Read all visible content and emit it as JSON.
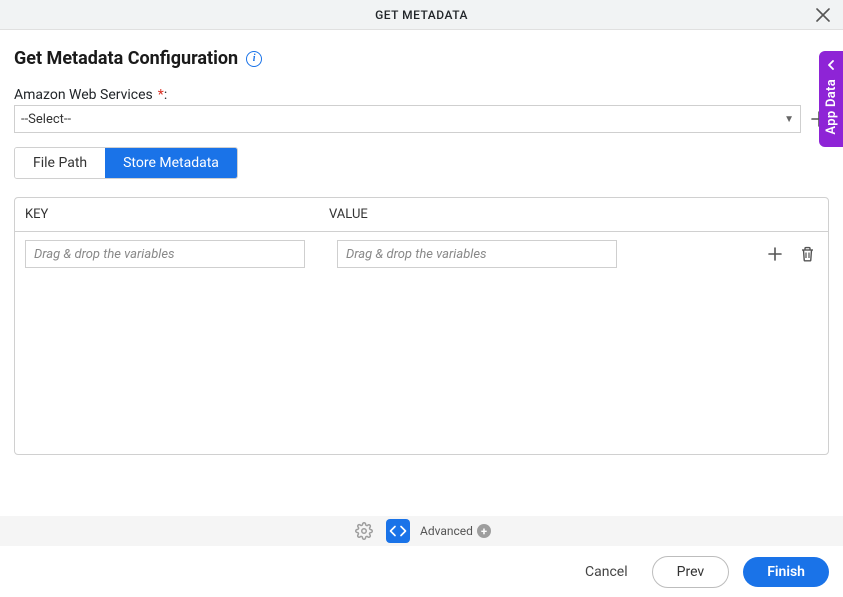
{
  "header": {
    "title": "GET METADATA"
  },
  "page": {
    "title": "Get Metadata Configuration"
  },
  "connection": {
    "label": "Amazon Web Services",
    "required_marker": "*",
    "colon": ":",
    "selected": "--Select--"
  },
  "tabs": {
    "file_path": "File Path",
    "store_metadata": "Store Metadata"
  },
  "kv": {
    "key_header": "KEY",
    "value_header": "VALUE",
    "placeholder": "Drag & drop the variables"
  },
  "side": {
    "label": "App Data"
  },
  "footer_tools": {
    "advanced": "Advanced"
  },
  "actions": {
    "cancel": "Cancel",
    "prev": "Prev",
    "finish": "Finish"
  }
}
